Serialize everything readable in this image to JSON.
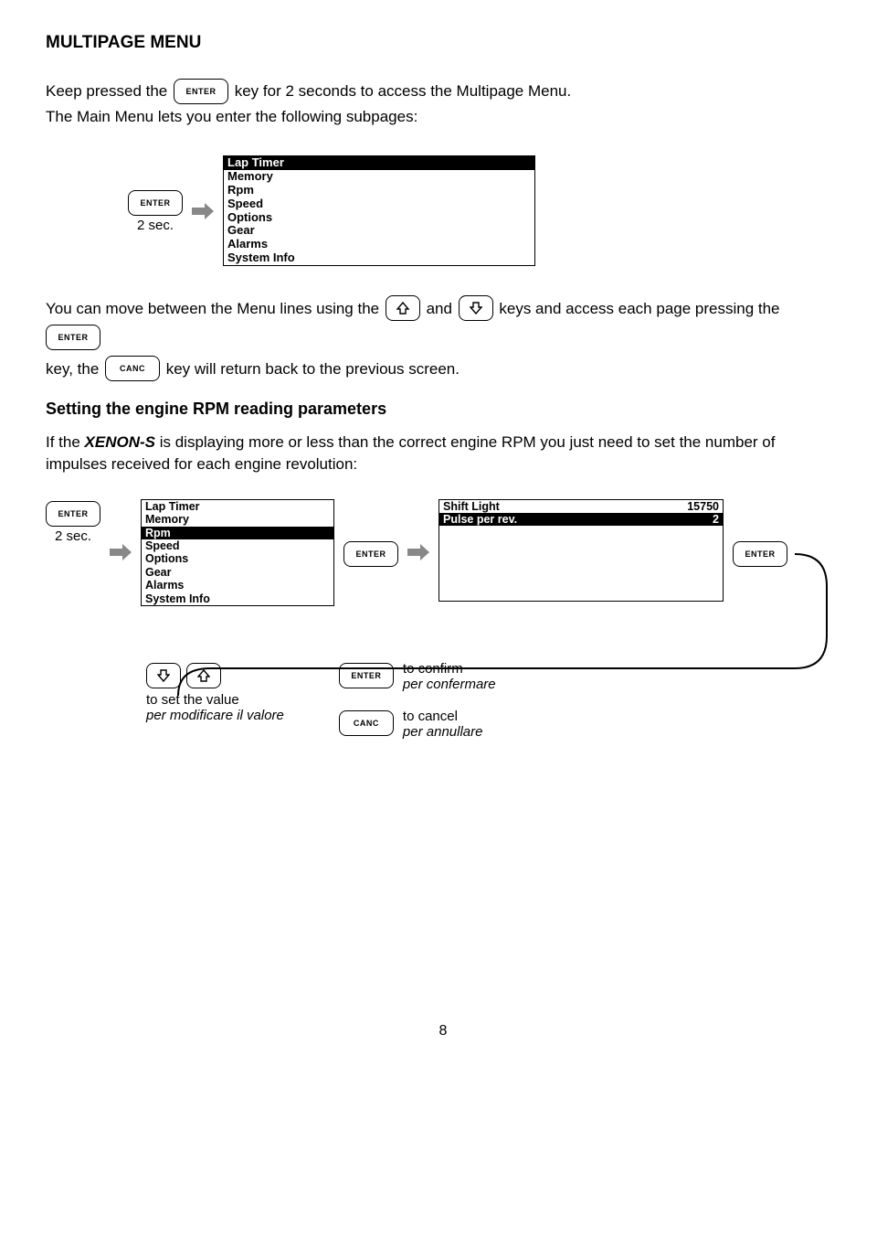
{
  "heading": "MULTIPAGE MENU",
  "intro": {
    "p1a": "Keep pressed the ",
    "p1b": " key for 2 seconds to access the Multipage Menu.",
    "p2": "The Main Menu lets you enter the following subpages:"
  },
  "keys": {
    "enter": "ENTER",
    "canc": "CANC",
    "two_sec": "2 sec."
  },
  "menu1": {
    "items": [
      "Lap Timer",
      "Memory",
      "Rpm",
      "Speed",
      "Options",
      "Gear",
      "Alarms",
      "System Info"
    ],
    "selected_index": 0
  },
  "nav": {
    "p3a": "You can move between the Menu lines using the ",
    "p3_and": " and ",
    "p3b": " keys and access each page pressing the ",
    "p4a": "key, the ",
    "p4b": " key will return back to the previous screen."
  },
  "subhead": "Setting the engine  RPM reading parameters",
  "rpm_para": {
    "a": "If the ",
    "product": "XENON-S",
    "b": "  is displaying more or less  than the correct engine RPM you just need to  set the number of impulses received for each engine revolution:"
  },
  "menu2": {
    "items": [
      "Lap Timer",
      "Memory",
      "Rpm",
      "Speed",
      "Options",
      "Gear",
      "Alarms",
      "System Info"
    ],
    "selected_index": 2
  },
  "rpm_screen": {
    "row1_label": "Shift Light",
    "row1_value": "15750",
    "row2_label": "Pulse per rev.",
    "row2_value": "2"
  },
  "actions": {
    "set_en": "to set the value",
    "set_it": "per modificare il valore",
    "confirm_en": "to confirm",
    "confirm_it": "per confermare",
    "cancel_en": "to cancel",
    "cancel_it": "per annullare"
  },
  "page": "8"
}
